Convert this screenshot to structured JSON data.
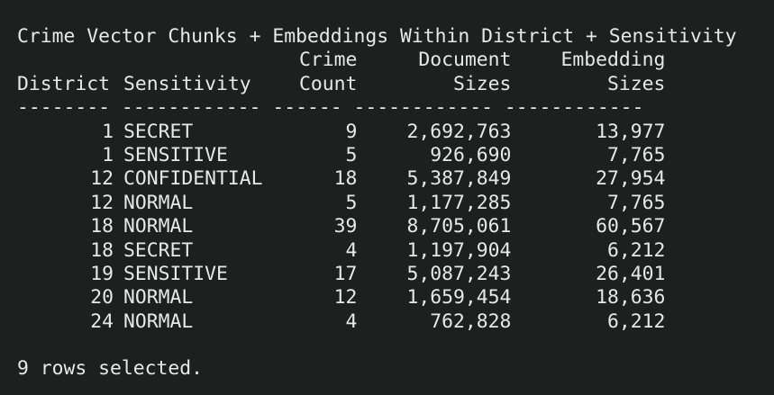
{
  "title": "Crime Vector Chunks + Embeddings Within District + Sensitivity",
  "headers": {
    "line1": {
      "district": "",
      "sensitivity": "",
      "crime_count": "Crime",
      "document_sizes": "Document",
      "embedding_sizes": "Embedding"
    },
    "line2": {
      "district": "District",
      "sensitivity": "Sensitivity",
      "crime_count": "Count",
      "document_sizes": "Sizes",
      "embedding_sizes": "Sizes"
    }
  },
  "separator": "-------- ------------ ------ ------------ ------------",
  "rows": [
    {
      "district": "1",
      "sensitivity": "SECRET",
      "crime_count": "9",
      "document_sizes": "2,692,763",
      "embedding_sizes": "13,977"
    },
    {
      "district": "1",
      "sensitivity": "SENSITIVE",
      "crime_count": "5",
      "document_sizes": "926,690",
      "embedding_sizes": "7,765"
    },
    {
      "district": "12",
      "sensitivity": "CONFIDENTIAL",
      "crime_count": "18",
      "document_sizes": "5,387,849",
      "embedding_sizes": "27,954"
    },
    {
      "district": "12",
      "sensitivity": "NORMAL",
      "crime_count": "5",
      "document_sizes": "1,177,285",
      "embedding_sizes": "7,765"
    },
    {
      "district": "18",
      "sensitivity": "NORMAL",
      "crime_count": "39",
      "document_sizes": "8,705,061",
      "embedding_sizes": "60,567"
    },
    {
      "district": "18",
      "sensitivity": "SECRET",
      "crime_count": "4",
      "document_sizes": "1,197,904",
      "embedding_sizes": "6,212"
    },
    {
      "district": "19",
      "sensitivity": "SENSITIVE",
      "crime_count": "17",
      "document_sizes": "5,087,243",
      "embedding_sizes": "26,401"
    },
    {
      "district": "20",
      "sensitivity": "NORMAL",
      "crime_count": "12",
      "document_sizes": "1,659,454",
      "embedding_sizes": "18,636"
    },
    {
      "district": "24",
      "sensitivity": "NORMAL",
      "crime_count": "4",
      "document_sizes": "762,828",
      "embedding_sizes": "6,212"
    }
  ],
  "footer": "9 rows selected."
}
